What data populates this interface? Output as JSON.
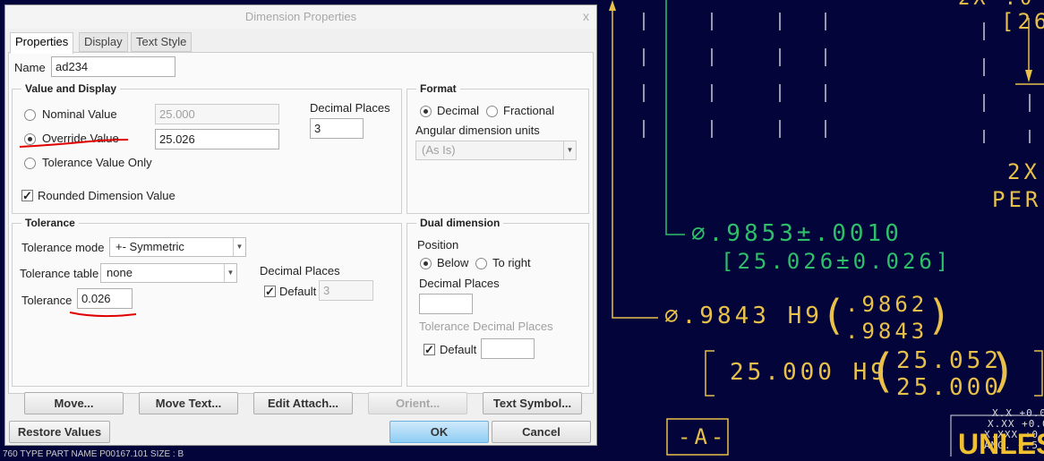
{
  "dialog": {
    "title": "Dimension Properties",
    "close": "x",
    "tabs": [
      {
        "label": "Properties",
        "active": true
      },
      {
        "label": "Display"
      },
      {
        "label": "Text Style"
      }
    ],
    "name_label": "Name",
    "name_value": "ad234",
    "value_display": {
      "title": "Value and Display",
      "nominal_label": "Nominal Value",
      "nominal_value": "25.000",
      "override_label": "Override Value",
      "override_value": "25.026",
      "tolerance_only_label": "Tolerance Value Only",
      "selected": "Override Value",
      "decimal_places_label": "Decimal Places",
      "decimal_places": "3",
      "rounded_label": "Rounded Dimension Value",
      "rounded_checked": true
    },
    "format": {
      "title": "Format",
      "decimal_label": "Decimal",
      "fractional_label": "Fractional",
      "selected": "Decimal",
      "angular_label": "Angular dimension units",
      "angular_value": "(As Is)"
    },
    "tolerance": {
      "title": "Tolerance",
      "mode_label": "Tolerance mode",
      "mode_value": "+- Symmetric",
      "table_label": "Tolerance table",
      "table_value": "none",
      "tolerance_label": "Tolerance",
      "tolerance_value": "0.026",
      "decimal_places_label": "Decimal Places",
      "default_label": "Default",
      "default_checked": true,
      "decimal_places": "3"
    },
    "dual": {
      "title": "Dual dimension",
      "position_label": "Position",
      "below_label": "Below",
      "to_right_label": "To right",
      "selected": "Below",
      "decimal_places_label": "Decimal Places",
      "decimal_places": "",
      "tol_decimal_label": "Tolerance Decimal Places",
      "default_label": "Default",
      "default_checked": true,
      "tol_decimal_value": ""
    },
    "buttons": {
      "move": "Move...",
      "move_text": "Move Text...",
      "edit_attach": "Edit Attach...",
      "orient": "Orient...",
      "text_symbol": "Text Symbol...",
      "restore": "Restore Values",
      "ok": "OK",
      "cancel": "Cancel"
    }
  },
  "drawing": {
    "green_dim": ".9853±.0010",
    "green_dual": "[25.026±0.026]",
    "yellow_dim": ".9843 H9",
    "yellow_upper": ".9862",
    "yellow_lower": ".9843",
    "dual_dim": "25.000 H9",
    "dual_upper": "25.052",
    "dual_lower": "25.000",
    "datum": "-A-",
    "note_2x": "2X",
    "note_per": "PER",
    "top_right": "[26",
    "top_right2": "2X  .0",
    "unless": "UNLES",
    "tol_xx": "X.X  +0.0",
    "tol_xxx": "X.XX +0.0",
    "tol_xxxx": "X.XXX +0.0",
    "tol_ang": "ANG. +.5",
    "footer": "760   TYPE  PART   NAME  P00167.101     SIZE : B",
    "colors": {
      "background": "#03053a",
      "yellow": "#e8c04a",
      "green": "#2fbf6a",
      "annotation": "#e00000"
    }
  }
}
